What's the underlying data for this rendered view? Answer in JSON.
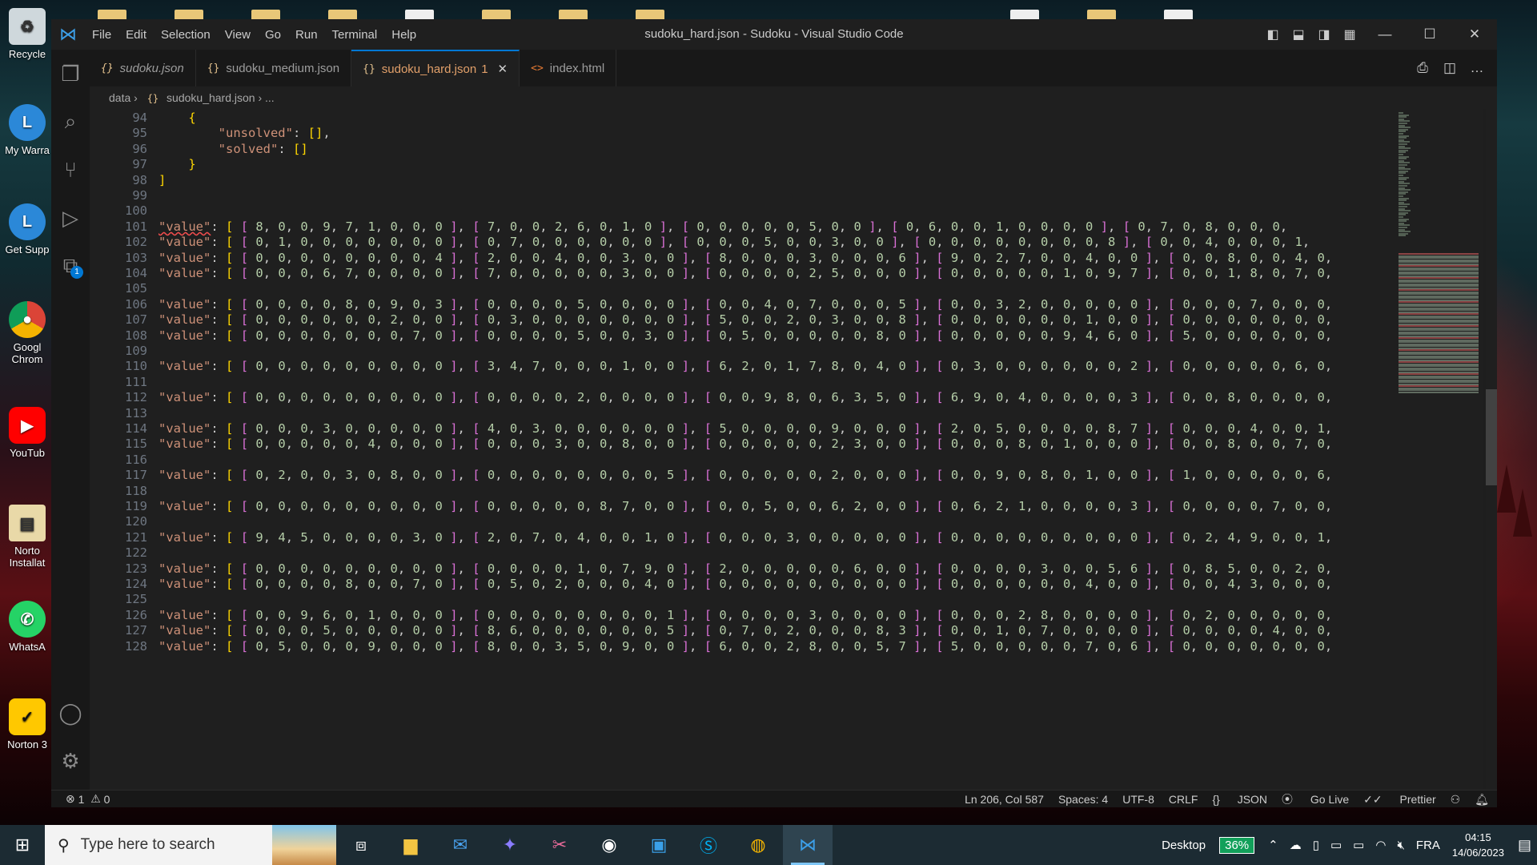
{
  "window": {
    "title": "sudoku_hard.json - Sudoku - Visual Studio Code",
    "menu": [
      "File",
      "Edit",
      "Selection",
      "View",
      "Go",
      "Run",
      "Terminal",
      "Help"
    ]
  },
  "tabs": [
    {
      "label": "sudoku.json",
      "icon": "{}",
      "active": false,
      "italic": true
    },
    {
      "label": "sudoku_medium.json",
      "icon": "{}",
      "active": false
    },
    {
      "label": "sudoku_hard.json",
      "icon": "{}",
      "active": true,
      "modified": "1"
    },
    {
      "label": "index.html",
      "icon": "<>",
      "active": false
    }
  ],
  "breadcrumb": {
    "folder": "data",
    "file": "sudoku_hard.json",
    "more": "..."
  },
  "editor": {
    "lines": [
      {
        "n": "94",
        "t": "    {"
      },
      {
        "n": "95",
        "t": "        \"unsolved\": [],"
      },
      {
        "n": "96",
        "t": "        \"solved\": []"
      },
      {
        "n": "97",
        "t": "    }"
      },
      {
        "n": "98",
        "t": "]"
      },
      {
        "n": "99",
        "t": ""
      },
      {
        "n": "100",
        "t": ""
      },
      {
        "n": "101",
        "t": "\"value\": [ [ 8, 0, 0, 9, 7, 1, 0, 0, 0 ], [ 7, 0, 0, 2, 6, 0, 1, 0 ], [ 0, 0, 0, 0, 0, 5, 0, 0 ], [ 0, 6, 0, 0, 1, 0, 0, 0, 0 ], [ 0, 7, 0, 8, 0, 0, 0,"
      },
      {
        "n": "102",
        "t": "\"value\": [ [ 0, 1, 0, 0, 0, 0, 0, 0, 0 ], [ 0, 7, 0, 0, 0, 0, 0, 0 ], [ 0, 0, 0, 5, 0, 0, 3, 0, 0 ], [ 0, 0, 0, 0, 0, 0, 0, 0, 8 ], [ 0, 0, 4, 0, 0, 0, 1,"
      },
      {
        "n": "103",
        "t": "\"value\": [ [ 0, 0, 0, 0, 0, 0, 0, 0, 4 ], [ 2, 0, 0, 4, 0, 0, 3, 0, 0 ], [ 8, 0, 0, 0, 3, 0, 0, 0, 6 ], [ 9, 0, 2, 7, 0, 0, 4, 0, 0 ], [ 0, 0, 8, 0, 0, 4, 0,"
      },
      {
        "n": "104",
        "t": "\"value\": [ [ 0, 0, 0, 6, 7, 0, 0, 0, 0 ], [ 7, 0, 0, 0, 0, 0, 3, 0, 0 ], [ 0, 0, 0, 0, 2, 5, 0, 0, 0 ], [ 0, 0, 0, 0, 0, 1, 0, 9, 7 ], [ 0, 0, 1, 8, 0, 7, 0,"
      },
      {
        "n": "105",
        "t": ""
      },
      {
        "n": "106",
        "t": "\"value\": [ [ 0, 0, 0, 0, 8, 0, 9, 0, 3 ], [ 0, 0, 0, 0, 5, 0, 0, 0, 0 ], [ 0, 0, 4, 0, 7, 0, 0, 0, 5 ], [ 0, 0, 3, 2, 0, 0, 0, 0, 0 ], [ 0, 0, 0, 7, 0, 0, 0,"
      },
      {
        "n": "107",
        "t": "\"value\": [ [ 0, 0, 0, 0, 0, 0, 2, 0, 0 ], [ 0, 3, 0, 0, 0, 0, 0, 0, 0 ], [ 5, 0, 0, 2, 0, 3, 0, 0, 8 ], [ 0, 0, 0, 0, 0, 0, 1, 0, 0 ], [ 0, 0, 0, 0, 0, 0, 0,"
      },
      {
        "n": "108",
        "t": "\"value\": [ [ 0, 0, 0, 0, 0, 0, 0, 7, 0 ], [ 0, 0, 0, 0, 5, 0, 0, 3, 0 ], [ 0, 5, 0, 0, 0, 0, 0, 8, 0 ], [ 0, 0, 0, 0, 0, 9, 4, 6, 0 ], [ 5, 0, 0, 0, 0, 0, 0,"
      },
      {
        "n": "109",
        "t": ""
      },
      {
        "n": "110",
        "t": "\"value\": [ [ 0, 0, 0, 0, 0, 0, 0, 0, 0 ], [ 3, 4, 7, 0, 0, 0, 1, 0, 0 ], [ 6, 2, 0, 1, 7, 8, 0, 4, 0 ], [ 0, 3, 0, 0, 0, 0, 0, 0, 2 ], [ 0, 0, 0, 0, 0, 6, 0,"
      },
      {
        "n": "111",
        "t": ""
      },
      {
        "n": "112",
        "t": "\"value\": [ [ 0, 0, 0, 0, 0, 0, 0, 0, 0 ], [ 0, 0, 0, 0, 2, 0, 0, 0, 0 ], [ 0, 0, 9, 8, 0, 6, 3, 5, 0 ], [ 6, 9, 0, 4, 0, 0, 0, 0, 3 ], [ 0, 0, 8, 0, 0, 0, 0,"
      },
      {
        "n": "113",
        "t": ""
      },
      {
        "n": "114",
        "t": "\"value\": [ [ 0, 0, 0, 3, 0, 0, 0, 0, 0 ], [ 4, 0, 3, 0, 0, 0, 0, 0, 0 ], [ 5, 0, 0, 0, 0, 9, 0, 0, 0 ], [ 2, 0, 5, 0, 0, 0, 0, 8, 7 ], [ 0, 0, 0, 4, 0, 0, 1,"
      },
      {
        "n": "115",
        "t": "\"value\": [ [ 0, 0, 0, 0, 0, 4, 0, 0, 0 ], [ 0, 0, 0, 3, 0, 0, 8, 0, 0 ], [ 0, 0, 0, 0, 0, 2, 3, 0, 0 ], [ 0, 0, 0, 8, 0, 1, 0, 0, 0 ], [ 0, 0, 8, 0, 0, 7, 0,"
      },
      {
        "n": "116",
        "t": ""
      },
      {
        "n": "117",
        "t": "\"value\": [ [ 0, 2, 0, 0, 3, 0, 8, 0, 0 ], [ 0, 0, 0, 0, 0, 0, 0, 0, 5 ], [ 0, 0, 0, 0, 0, 2, 0, 0, 0 ], [ 0, 0, 9, 0, 8, 0, 1, 0, 0 ], [ 1, 0, 0, 0, 0, 0, 6,"
      },
      {
        "n": "118",
        "t": ""
      },
      {
        "n": "119",
        "t": "\"value\": [ [ 0, 0, 0, 0, 0, 0, 0, 0, 0 ], [ 0, 0, 0, 0, 0, 8, 7, 0, 0 ], [ 0, 0, 5, 0, 0, 6, 2, 0, 0 ], [ 0, 6, 2, 1, 0, 0, 0, 0, 3 ], [ 0, 0, 0, 0, 7, 0, 0,"
      },
      {
        "n": "120",
        "t": ""
      },
      {
        "n": "121",
        "t": "\"value\": [ [ 9, 4, 5, 0, 0, 0, 0, 3, 0 ], [ 2, 0, 7, 0, 4, 0, 0, 1, 0 ], [ 0, 0, 0, 3, 0, 0, 0, 0, 0 ], [ 0, 0, 0, 0, 0, 0, 0, 0, 0 ], [ 0, 2, 4, 9, 0, 0, 1,"
      },
      {
        "n": "122",
        "t": ""
      },
      {
        "n": "123",
        "t": "\"value\": [ [ 0, 0, 0, 0, 0, 0, 0, 0, 0 ], [ 0, 0, 0, 0, 1, 0, 7, 9, 0 ], [ 2, 0, 0, 0, 0, 0, 6, 0, 0 ], [ 0, 0, 0, 0, 3, 0, 0, 5, 6 ], [ 0, 8, 5, 0, 0, 2, 0,"
      },
      {
        "n": "124",
        "t": "\"value\": [ [ 0, 0, 0, 0, 8, 0, 0, 7, 0 ], [ 0, 5, 0, 2, 0, 0, 0, 4, 0 ], [ 0, 0, 0, 0, 0, 0, 0, 0, 0 ], [ 0, 0, 0, 0, 0, 0, 4, 0, 0 ], [ 0, 0, 4, 3, 0, 0, 0,"
      },
      {
        "n": "125",
        "t": ""
      },
      {
        "n": "126",
        "t": "\"value\": [ [ 0, 0, 9, 6, 0, 1, 0, 0, 0 ], [ 0, 0, 0, 0, 0, 0, 0, 0, 1 ], [ 0, 0, 0, 0, 3, 0, 0, 0, 0 ], [ 0, 0, 0, 2, 8, 0, 0, 0, 0 ], [ 0, 2, 0, 0, 0, 0, 0,"
      },
      {
        "n": "127",
        "t": "\"value\": [ [ 0, 0, 0, 5, 0, 0, 0, 0, 0 ], [ 8, 6, 0, 0, 0, 0, 0, 0, 5 ], [ 0, 7, 0, 2, 0, 0, 0, 8, 3 ], [ 0, 0, 1, 0, 7, 0, 0, 0, 0 ], [ 0, 0, 0, 0, 4, 0, 0,"
      },
      {
        "n": "128",
        "t": "\"value\": [ [ 0, 5, 0, 0, 0, 9, 0, 0, 0 ], [ 8, 0, 0, 3, 5, 0, 9, 0, 0 ], [ 6, 0, 0, 2, 8, 0, 0, 5, 7 ], [ 5, 0, 0, 0, 0, 0, 7, 0, 6 ], [ 0, 0, 0, 0, 0, 0, 0,"
      }
    ]
  },
  "status": {
    "errors": "1",
    "warnings": "0",
    "position": "Ln 206, Col 587",
    "spaces": "Spaces: 4",
    "encoding": "UTF-8",
    "eol": "CRLF",
    "language": "JSON",
    "golive": "Go Live",
    "prettier": "Prettier"
  },
  "desktop": {
    "icons": [
      "Recycle",
      "My Warra",
      "Get Supp",
      "Googl Chrom",
      "YouTub",
      "Norto Installat",
      "WhatsA",
      "Norton 3"
    ]
  },
  "taskbar": {
    "search_placeholder": "Type here to search",
    "desktop_label": "Desktop",
    "battery": "36%",
    "language": "FRA",
    "time": "04:15",
    "date": "14/06/2023"
  },
  "colors": {
    "accent": "#0078d4",
    "editor_bg": "#1f1f1f",
    "string_key": "#ce9178",
    "number": "#b5cea8"
  }
}
